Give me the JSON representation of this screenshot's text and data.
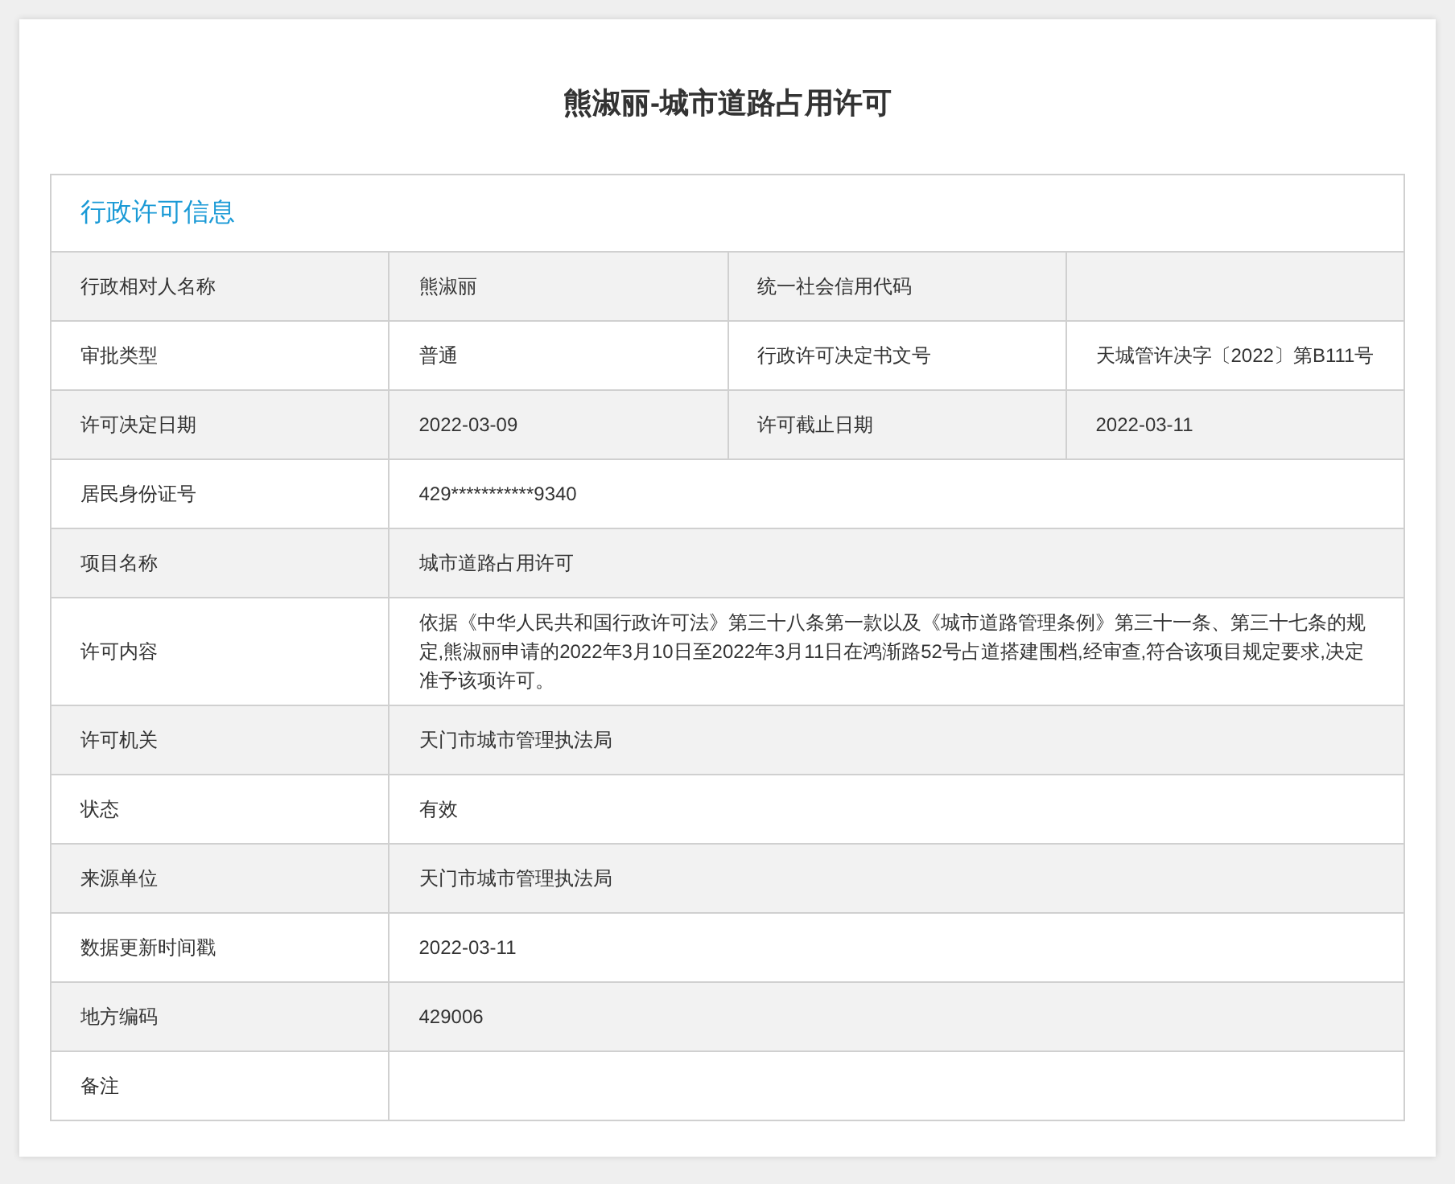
{
  "title": "熊淑丽-城市道路占用许可",
  "section": {
    "heading": "行政许可信息",
    "rows": [
      {
        "fields": [
          {
            "label": "行政相对人名称",
            "value": "熊淑丽"
          },
          {
            "label": "统一社会信用代码"
          }
        ]
      },
      {
        "fields": [
          {
            "label": "审批类型",
            "value": "普通"
          },
          {
            "label": "行政许可决定书文号",
            "value": "天城管许决字〔2022〕第B111号"
          }
        ]
      },
      {
        "fields": [
          {
            "label": "许可决定日期",
            "value": "2022-03-09"
          },
          {
            "label": "许可截止日期",
            "value": "2022-03-11"
          }
        ]
      },
      {
        "fields": [
          {
            "label": "居民身份证号",
            "value": "429***********9340"
          }
        ]
      },
      {
        "fields": [
          {
            "label": "项目名称",
            "value": "城市道路占用许可"
          }
        ]
      },
      {
        "fields": [
          {
            "label": "许可内容",
            "value": "依据《中华人民共和国行政许可法》第三十八条第一款以及《城市道路管理条例》第三十一条、第三十七条的规定,熊淑丽申请的2022年3月10日至2022年3月11日在鸿渐路52号占道搭建围档,经审查,符合该项目规定要求,决定准予该项许可。"
          }
        ]
      },
      {
        "fields": [
          {
            "label": "许可机关",
            "value": "天门市城市管理执法局"
          }
        ]
      },
      {
        "fields": [
          {
            "label": "状态",
            "value": "有效"
          }
        ]
      },
      {
        "fields": [
          {
            "label": "来源单位",
            "value": "天门市城市管理执法局"
          }
        ]
      },
      {
        "fields": [
          {
            "label": "数据更新时间戳",
            "value": "2022-03-11"
          }
        ]
      },
      {
        "fields": [
          {
            "label": "地方编码",
            "value": "429006"
          }
        ]
      },
      {
        "fields": [
          {
            "label": "备注"
          }
        ]
      }
    ]
  }
}
